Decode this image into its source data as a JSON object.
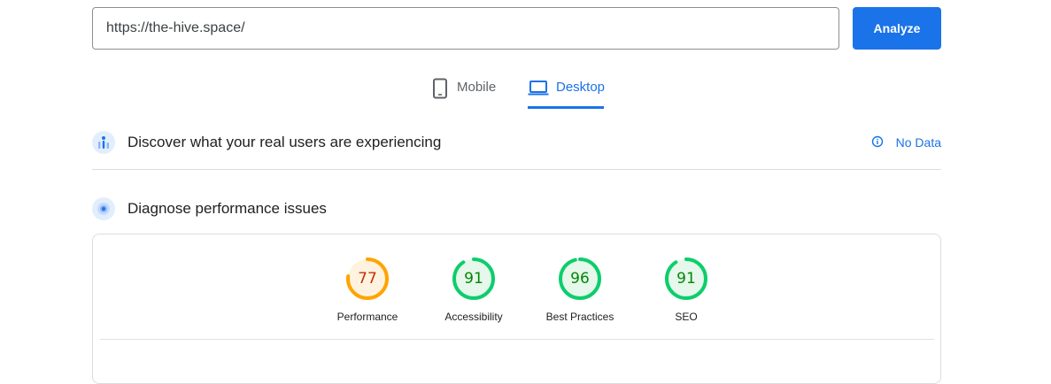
{
  "search": {
    "url_value": "https://the-hive.space/"
  },
  "analyze_label": "Analyze",
  "tabs": [
    {
      "label": "Mobile",
      "icon": "smartphone-icon",
      "selected": false
    },
    {
      "label": "Desktop",
      "icon": "laptop-icon",
      "selected": true
    }
  ],
  "field_data": {
    "title": "Discover what your real users are experiencing",
    "status_label": "No Data",
    "icon": "users-chart-icon",
    "status_icon": "info-icon"
  },
  "lab_data": {
    "title": "Diagnose performance issues",
    "icon": "radar-icon"
  },
  "scores": [
    {
      "label": "Performance",
      "value": 77,
      "color": "#ffa400",
      "text_color": "#c33300",
      "fill": "#fff3e0"
    },
    {
      "label": "Accessibility",
      "value": 91,
      "color": "#0cce6b",
      "text_color": "#008800",
      "fill": "#e6f7ec"
    },
    {
      "label": "Best Practices",
      "value": 96,
      "color": "#0cce6b",
      "text_color": "#008800",
      "fill": "#e6f7ec"
    },
    {
      "label": "SEO",
      "value": 91,
      "color": "#0cce6b",
      "text_color": "#008800",
      "fill": "#e6f7ec"
    }
  ],
  "colors": {
    "accent": "#1a73e8",
    "pass": "#0cce6b",
    "average": "#ffa400"
  }
}
